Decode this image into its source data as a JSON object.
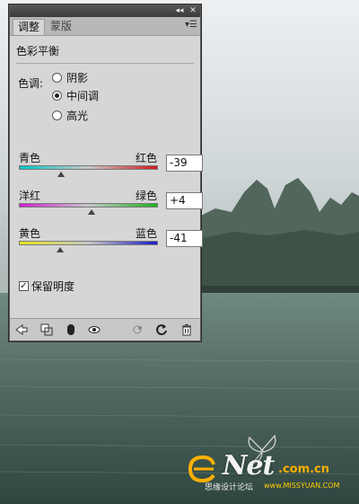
{
  "panel": {
    "controls": {
      "collapse": "◂◂",
      "close": "✕"
    },
    "tabs": [
      {
        "label": "调整"
      },
      {
        "label": "蒙版"
      }
    ],
    "menu_icon": "panel-menu-icon",
    "heading": "色彩平衡",
    "tone_label": "色调:",
    "tone_options": [
      {
        "label": "阴影",
        "selected": false
      },
      {
        "label": "中间调",
        "selected": true
      },
      {
        "label": "高光",
        "selected": false
      }
    ],
    "sliders": [
      {
        "left_label": "青色",
        "right_label": "红色",
        "value": "-39",
        "left_color": "#00c6c6",
        "right_color": "#d21a1a"
      },
      {
        "left_label": "洋红",
        "right_label": "绿色",
        "value": "+4",
        "left_color": "#d21ad2",
        "right_color": "#1ab21a"
      },
      {
        "left_label": "黄色",
        "right_label": "蓝色",
        "value": "-41",
        "left_color": "#e6e61a",
        "right_color": "#1a1ac8"
      }
    ],
    "preserve_luminosity": {
      "label": "保留明度",
      "checked": true
    },
    "bottom_icons": [
      "back-arrow-icon",
      "clip-layer-icon",
      "mask-icon",
      "visibility-eye-icon",
      "previous-state-icon",
      "reset-icon",
      "trash-icon"
    ]
  },
  "watermark": {
    "brand": "Net",
    "brand_tail": ".com.cn",
    "subtitle_cn": "思缘设计论坛",
    "subtitle_en": "www.MISSYUAN.COM"
  }
}
